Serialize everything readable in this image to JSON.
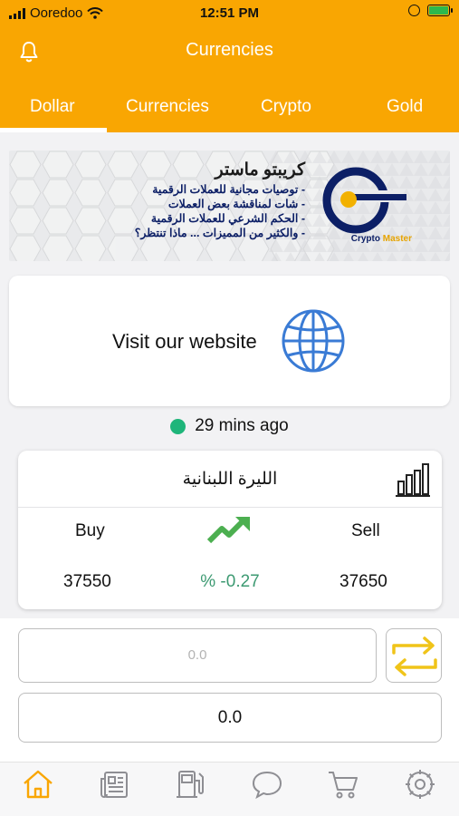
{
  "status_bar": {
    "carrier": "Ooredoo",
    "time": "12:51 PM"
  },
  "header": {
    "title": "Currencies",
    "tabs": [
      {
        "label": "Dollar",
        "active": true
      },
      {
        "label": "Currencies",
        "active": false
      },
      {
        "label": "Crypto",
        "active": false
      },
      {
        "label": "Gold",
        "active": false
      }
    ]
  },
  "banner": {
    "heading": "كريبتو ماستر",
    "lines": [
      "- توصيات مجانية للعملات الرقمية",
      "- شات لمناقشة بعض العملات",
      "- الحكم الشرعي للعملات الرقمية",
      "- والكثير من المميزات ... ماذا تنتظر؟"
    ],
    "logo_word1": "Crypto",
    "logo_word2": "Master"
  },
  "website_card": {
    "label": "Visit our website",
    "icon": "globe-icon"
  },
  "last_update": {
    "text": "29 mins ago",
    "status_color": "#1fb57a"
  },
  "rate_card": {
    "currency_name": "الليرة اللبنانية",
    "buy_label": "Buy",
    "sell_label": "Sell",
    "buy_value": "37550",
    "sell_value": "37650",
    "change": "% -0.27",
    "trend_color": "#4caf50"
  },
  "converter": {
    "input_placeholder": "0.0",
    "output_value": "0.0"
  },
  "bottom_nav": [
    {
      "icon": "home-icon",
      "active": true
    },
    {
      "icon": "news-icon",
      "active": false
    },
    {
      "icon": "fuel-icon",
      "active": false
    },
    {
      "icon": "chat-icon",
      "active": false
    },
    {
      "icon": "cart-icon",
      "active": false
    },
    {
      "icon": "settings-icon",
      "active": false
    }
  ],
  "colors": {
    "accent": "#f9a602",
    "inactive_icon": "#8e8e93"
  }
}
